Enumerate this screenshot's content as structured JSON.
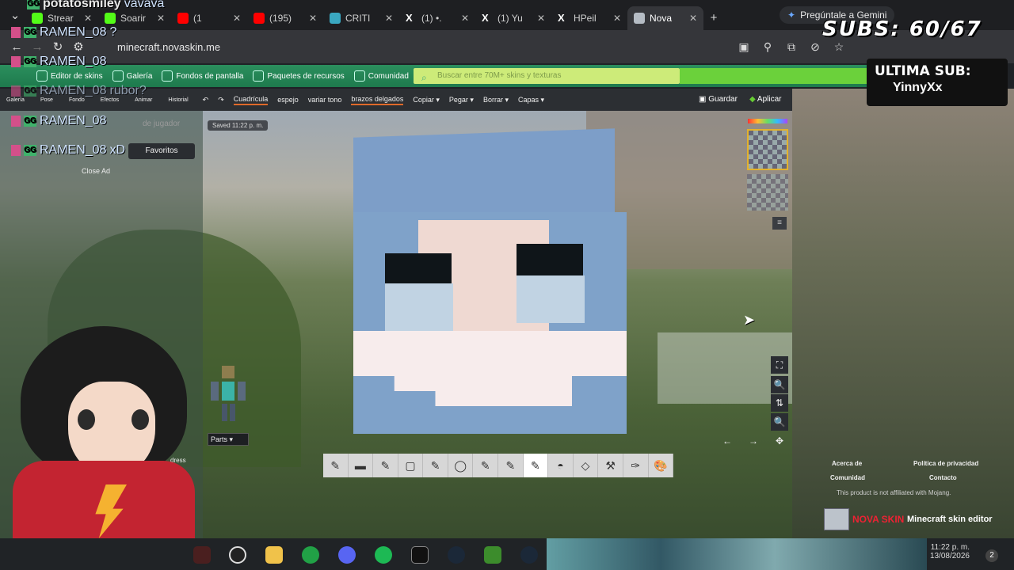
{
  "browser": {
    "tabs": [
      {
        "title": "Strear",
        "color": "#53fc18"
      },
      {
        "title": "Soarir",
        "color": "#53fc18"
      },
      {
        "title": "(1",
        "color": "#ff0000"
      },
      {
        "title": "(195)",
        "color": "#ff0000"
      },
      {
        "title": "CRITI",
        "color": "#3aa8c1"
      },
      {
        "title": "(1) •.",
        "color": "#ffffff"
      },
      {
        "title": "(1) Yu",
        "color": "#ffffff"
      },
      {
        "title": "HPeil",
        "color": "#ffffff"
      },
      {
        "title": "Nova",
        "color": "#b5bcc4"
      }
    ],
    "gemini_label": "Pregúntale a Gemini",
    "url": "minecraft.novaskin.me"
  },
  "site": {
    "nav": [
      "Editor de skins",
      "Galería",
      "Fondos de pantalla",
      "Paquetes de recursos",
      "Comunidad"
    ],
    "search_placeholder": "Buscar entre 70M+ skins y texturas",
    "toolbar_left": [
      "Galería",
      "Pose",
      "Fondo",
      "Efectos",
      "Animar",
      "Historial"
    ],
    "toolbar": [
      "Cuadrícula",
      "espejo",
      "variar tono",
      "brazos delgados",
      "Copiar ▾",
      "Pegar ▾",
      "Borrar ▾",
      "Capas ▾"
    ],
    "save_label": "Guardar",
    "apply_label": "Aplicar",
    "saved_chip": "Saved 11:22 p. m.",
    "player_placeholder": "de jugador",
    "favorites_label": "Favoritos",
    "close_ad": "Close Ad",
    "parts_label": "Parts",
    "dress_label": "dress",
    "footer": {
      "about": "Acerca de",
      "privacy": "Política de privacidad",
      "community": "Comunidad",
      "contact": "Contacto",
      "note": "This product is not affiliated with Mojang.",
      "brand": "NOVA SKIN",
      "brand_sub": "Minecraft skin editor"
    }
  },
  "overlay": {
    "subs": "SUBS: 60/67",
    "last_sub_label": "ULTIMA SUB:",
    "last_sub_name": "YinnyXx"
  },
  "chat": [
    {
      "user": "potatosmiley",
      "msg": "vavava"
    },
    {
      "user": "RAMEN_08",
      "msg": "?"
    },
    {
      "user": "RAMEN_08",
      "msg": ""
    },
    {
      "user": "RAMEN_08",
      "msg": "rubor?"
    },
    {
      "user": "RAMEN_08",
      "msg": ""
    },
    {
      "user": "RAMEN_08",
      "msg": "xD"
    }
  ],
  "taskbar": {
    "time": "11:22 p. m.",
    "date": "13/08/2026",
    "badge": "2"
  }
}
